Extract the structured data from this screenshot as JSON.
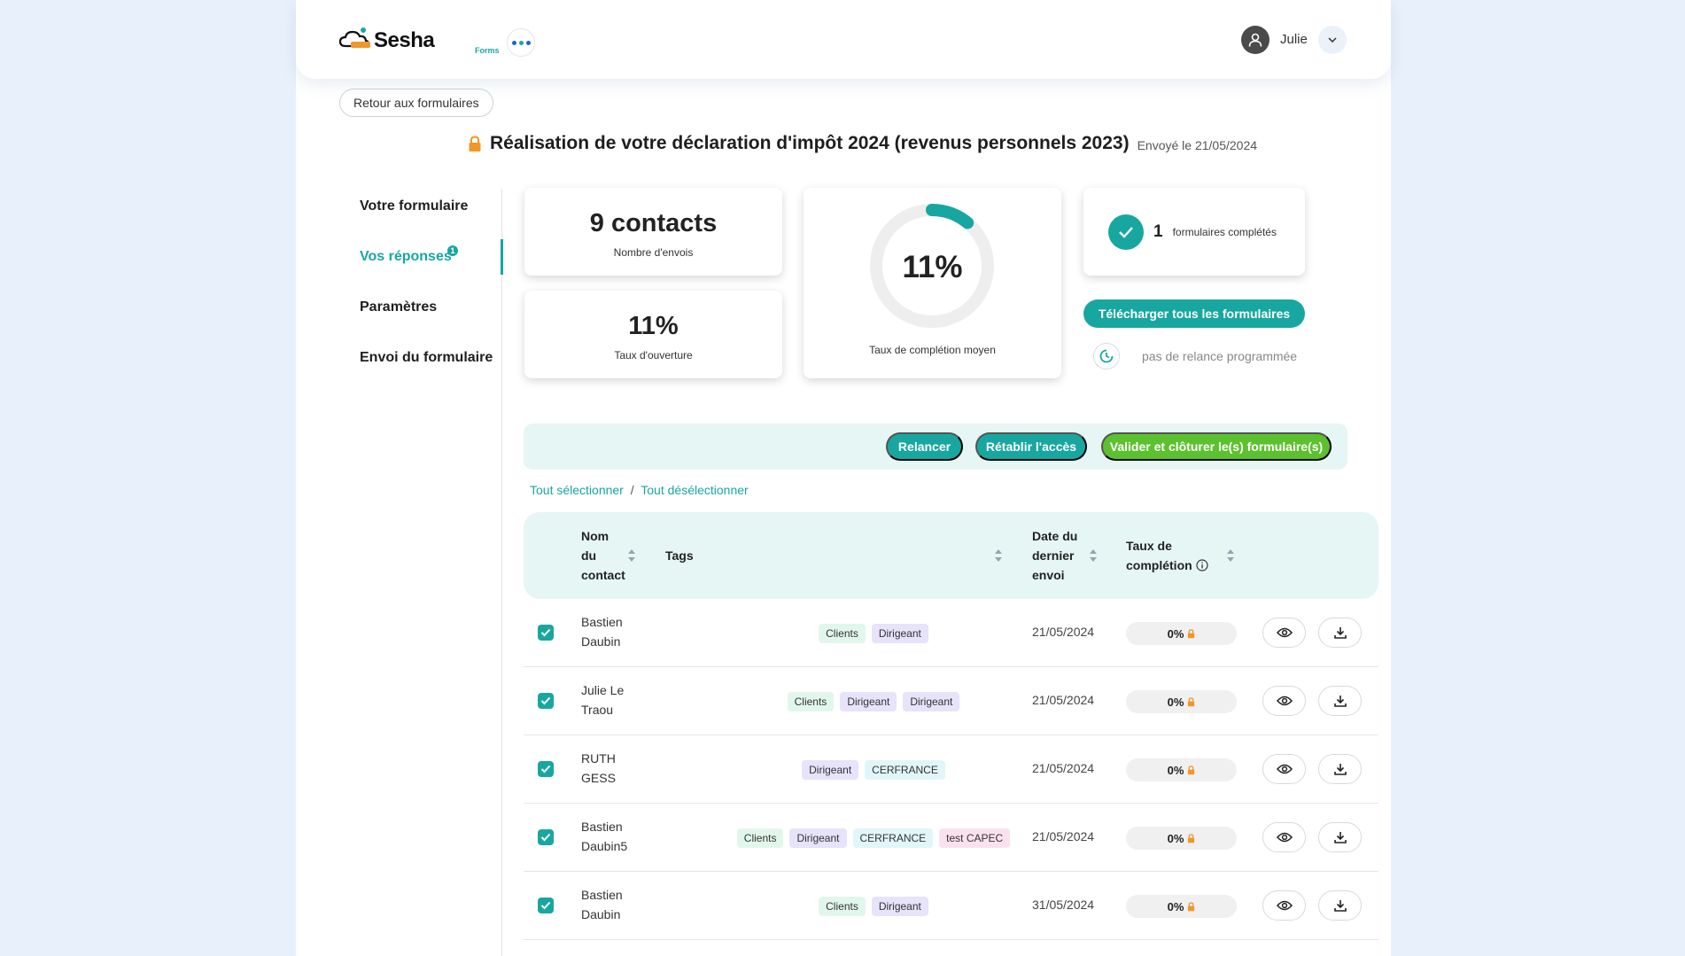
{
  "header": {
    "logo_text": "Sesha",
    "logo_sub": "Forms",
    "user_name": "Julie"
  },
  "back_button": "Retour aux formulaires",
  "form": {
    "title": "Réalisation de votre déclaration d'impôt 2024 (revenus personnels 2023)",
    "sent": "Envoyé le 21/05/2024"
  },
  "nav": {
    "items": [
      {
        "label": "Votre formulaire"
      },
      {
        "label": "Vos réponses",
        "badge": "1"
      },
      {
        "label": "Paramètres"
      },
      {
        "label": "Envoi du formulaire"
      }
    ]
  },
  "stats": {
    "contacts_value": "9 contacts",
    "contacts_label": "Nombre d'envois",
    "open_value": "11%",
    "open_label": "Taux d'ouverture",
    "completion_value": "11%",
    "completion_fraction": 0.11,
    "completion_label": "Taux de complétion moyen",
    "completed_count": "1",
    "completed_label": "formulaires complétés"
  },
  "download_all": "Télécharger tous les formulaires",
  "relance_status": "pas de relance programmée",
  "actions": {
    "relancer": "Relancer",
    "retablir": "Rétablir l'accès",
    "valider": "Valider et clôturer le(s) formulaire(s)"
  },
  "selection": {
    "select_all": "Tout sélectionner",
    "separator": "/",
    "deselect_all": "Tout désélectionner"
  },
  "table": {
    "headers": {
      "name_l1": "Nom",
      "name_l2": "du",
      "name_l3": "contact",
      "tags": "Tags",
      "date_l1": "Date du",
      "date_l2": "dernier",
      "date_l3": "envoi",
      "rate_l1": "Taux de",
      "rate_l2": "complétion"
    },
    "rows": [
      {
        "name_l1": "Bastien",
        "name_l2": "Daubin",
        "date": "21/05/2024",
        "rate": "0%",
        "checked": true,
        "tags": [
          {
            "label": "Clients",
            "color": "green"
          },
          {
            "label": "Dirigeant",
            "color": "purple"
          }
        ]
      },
      {
        "name_l1": "Julie Le",
        "name_l2": "Traou",
        "date": "21/05/2024",
        "rate": "0%",
        "checked": true,
        "tags": [
          {
            "label": "Clients",
            "color": "green"
          },
          {
            "label": "Dirigeant",
            "color": "purple"
          },
          {
            "label": "Dirigeant",
            "color": "purple"
          }
        ]
      },
      {
        "name_l1": "RUTH",
        "name_l2": "GESS",
        "date": "21/05/2024",
        "rate": "0%",
        "checked": true,
        "tags": [
          {
            "label": "Dirigeant",
            "color": "purple"
          },
          {
            "label": "CERFRANCE",
            "color": "cyan"
          }
        ]
      },
      {
        "name_l1": "Bastien",
        "name_l2": "Daubin5",
        "date": "21/05/2024",
        "rate": "0%",
        "checked": true,
        "tags": [
          {
            "label": "Clients",
            "color": "green"
          },
          {
            "label": "Dirigeant",
            "color": "purple"
          },
          {
            "label": "CERFRANCE",
            "color": "cyan"
          },
          {
            "label": "test CAPEC",
            "color": "pink"
          }
        ]
      },
      {
        "name_l1": "Bastien",
        "name_l2": "Daubin",
        "date": "31/05/2024",
        "rate": "0%",
        "checked": true,
        "tags": [
          {
            "label": "Clients",
            "color": "green"
          },
          {
            "label": "Dirigeant",
            "color": "purple"
          }
        ]
      }
    ]
  },
  "colors": {
    "accent": "#18a7a0",
    "success": "#5cc12e",
    "lock": "#f0962a"
  },
  "icons": [
    "cloud-logo-icon",
    "more-dots-icon",
    "user-icon",
    "chevron-down-icon",
    "lock-icon",
    "check-icon",
    "clock-icon",
    "sort-icon",
    "info-icon",
    "eye-icon",
    "download-icon"
  ]
}
